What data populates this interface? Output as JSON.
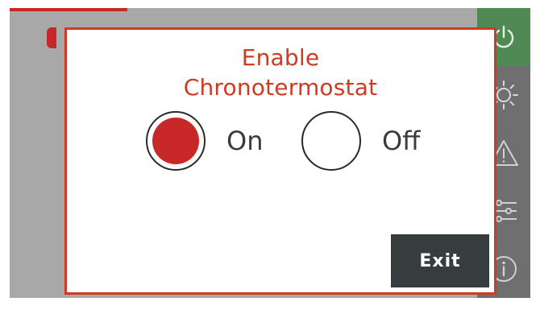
{
  "dialog": {
    "title_line1": "Enable",
    "title_line2": "Chronotermostat",
    "options": [
      {
        "label": "On",
        "selected": true
      },
      {
        "label": "Off",
        "selected": false
      }
    ],
    "exit_label": "Exit"
  },
  "sidebar": {
    "icons": [
      "power-icon",
      "sun-icon",
      "warning-icon",
      "sliders-icon",
      "info-icon"
    ]
  },
  "colors": {
    "accent_red": "#cc3b22",
    "radio_fill": "#c92828",
    "sidebar_active": "#4f8a55",
    "sidebar_bg": "#6f6f6f",
    "exit_bg": "#373d3f"
  }
}
